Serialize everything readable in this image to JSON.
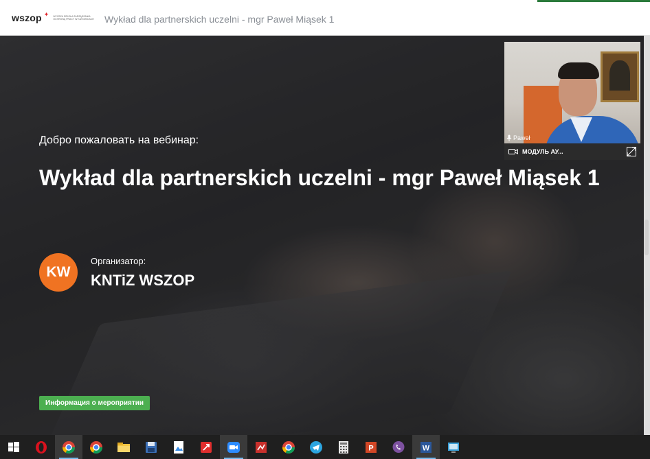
{
  "header": {
    "logo_text": "wszop",
    "logo_subtitle_lines": [
      "WYŻSZA SZKOŁA ZARZĄDZANIA",
      "OCHRONĄ PRACY W KATOWICACH"
    ],
    "title": "Wykład dla partnerskich uczelni - mgr Paweł Miąsek 1"
  },
  "hero": {
    "welcome": "Добро пожаловать на вебинар:",
    "title": "Wykład dla partnerskich uczelni - mgr Paweł Miąsek 1",
    "organizer_label": "Организатор:",
    "organizer_initials": "KW",
    "organizer_name": "KNTiZ WSZOP",
    "info_button": "Информация о мероприятии"
  },
  "video": {
    "participant_name": "Paweł",
    "module_label": "МОДУЛЬ АУ..."
  },
  "colors": {
    "avatar_bg": "#f07322",
    "button_bg": "#4caf50",
    "taskbar_bg": "#1f1f1f"
  },
  "taskbar": {
    "items": [
      {
        "icon": "windows-start-icon"
      },
      {
        "icon": "opera-icon"
      },
      {
        "icon": "chrome-user-icon"
      },
      {
        "icon": "chrome-icon"
      },
      {
        "icon": "file-explorer-icon"
      },
      {
        "icon": "save-disk-icon"
      },
      {
        "icon": "image-viewer-icon"
      },
      {
        "icon": "pdf-reader-icon"
      },
      {
        "icon": "zoom-icon"
      },
      {
        "icon": "presentation-icon"
      },
      {
        "icon": "chrome-icon-2"
      },
      {
        "icon": "telegram-icon"
      },
      {
        "icon": "calculator-icon"
      },
      {
        "icon": "powerpoint-icon"
      },
      {
        "icon": "viber-icon"
      },
      {
        "icon": "word-icon"
      },
      {
        "icon": "remote-desktop-icon"
      }
    ]
  }
}
